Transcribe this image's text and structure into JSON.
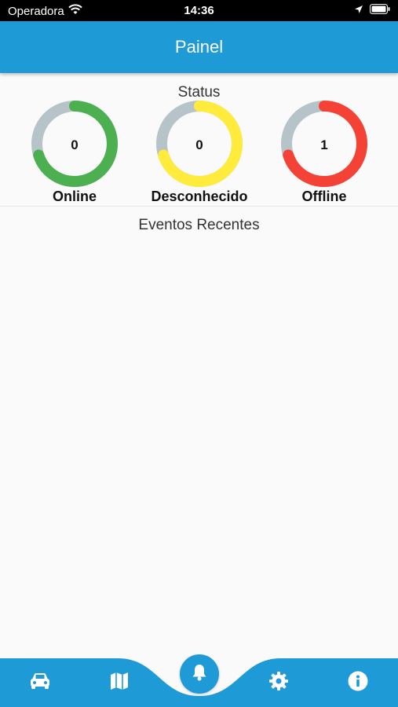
{
  "status_bar": {
    "carrier": "Operadora",
    "time": "14:36",
    "icons": [
      "wifi-icon",
      "location-arrow-icon",
      "battery-icon"
    ]
  },
  "app_bar": {
    "title": "Painel"
  },
  "status_section": {
    "title": "Status",
    "gauges": [
      {
        "label": "Online",
        "value": "0",
        "fraction": 0.7,
        "color": "#4caf50",
        "track_color": "#b6c3c9"
      },
      {
        "label": "Desconhecido",
        "value": "0",
        "fraction": 0.7,
        "color": "#ffeb3b",
        "track_color": "#b6c3c9"
      },
      {
        "label": "Offline",
        "value": "1",
        "fraction": 0.7,
        "color": "#f44336",
        "track_color": "#b6c3c9"
      }
    ]
  },
  "events_section": {
    "title": "Eventos Recentes",
    "items": []
  },
  "bottom_nav": {
    "items": [
      {
        "icon": "car-icon",
        "active": false
      },
      {
        "icon": "map-icon",
        "active": false
      },
      {
        "icon": "bell-icon",
        "active": true
      },
      {
        "icon": "gear-icon",
        "active": false
      },
      {
        "icon": "info-icon",
        "active": false
      }
    ],
    "color": "#1e9ad6"
  }
}
